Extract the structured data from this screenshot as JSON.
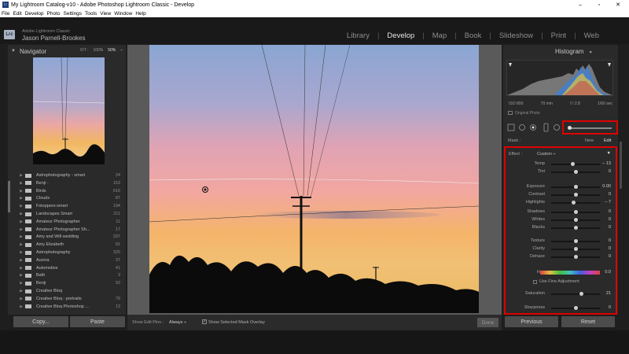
{
  "window": {
    "app_badge": "Lr",
    "title": "My Lightroom Catalog-v10 - Adobe Photoshop Lightroom Classic - Develop",
    "controls": [
      "–",
      "▫",
      "✕"
    ]
  },
  "menu": [
    "File",
    "Edit",
    "Develop",
    "Photo",
    "Settings",
    "Tools",
    "View",
    "Window",
    "Help"
  ],
  "identity": {
    "logo": "Lrc",
    "app_name": "Adobe Lightroom Classic",
    "user_name": "Jason Parnell-Brookes"
  },
  "modules": {
    "items": [
      "Library",
      "Develop",
      "Map",
      "Book",
      "Slideshow",
      "Print",
      "Web"
    ],
    "active": "Develop"
  },
  "navigator": {
    "title": "Navigator",
    "zoom_fit": "FIT :",
    "zoom_100": "100%",
    "zoom_50": "50%",
    "zoom_more": "÷"
  },
  "presets": [
    {
      "name": "Astrophotography - smart",
      "count": "24"
    },
    {
      "name": "Benji -",
      "count": "153"
    },
    {
      "name": "Birds",
      "count": "616"
    },
    {
      "name": "Clouds",
      "count": "87"
    },
    {
      "name": "Fstoppers-smart",
      "count": "194"
    },
    {
      "name": "Landscapes Smart",
      "count": "211"
    },
    {
      "name": "Amateur Photographer",
      "count": "11"
    },
    {
      "name": "Amateur Photographer Sh...",
      "count": "17"
    },
    {
      "name": "Amy and Will wedding",
      "count": "337"
    },
    {
      "name": "Amy Elizabeth",
      "count": "91"
    },
    {
      "name": "Astrophotography",
      "count": "325"
    },
    {
      "name": "Aurora",
      "count": "37"
    },
    {
      "name": "Automotive",
      "count": "41"
    },
    {
      "name": "Bath",
      "count": "3"
    },
    {
      "name": "Benji",
      "count": "93"
    },
    {
      "name": "Creative Bloq",
      "count": ""
    },
    {
      "name": "Creative Bloq - portraits",
      "count": "79"
    },
    {
      "name": "Creative Bloq Photoshop ...",
      "count": "13"
    }
  ],
  "left_buttons": {
    "copy": "Copy...",
    "paste": "Paste"
  },
  "toolbar": {
    "pins_label": "Show Edit Pins :",
    "pins_value": "Always ÷",
    "overlay_check": "✓",
    "overlay_label": "Show Selected Mask Overlay",
    "done": "Done"
  },
  "histogram": {
    "title": "Histogram",
    "iso": "ISO 800",
    "focal": "70 mm",
    "aperture": "f / 2.8",
    "shutter": "1/60 sec",
    "original": "Original Photo"
  },
  "mask": {
    "label": "Mask :",
    "new": "New",
    "edit": "Edit"
  },
  "effect": {
    "label": "Effect :",
    "value": "Custom ÷",
    "sliders": [
      {
        "name": "Temp",
        "value": "– 13",
        "position": 0.45
      },
      {
        "name": "Tint",
        "value": "0",
        "position": 0.5
      },
      {
        "name": "Exposure",
        "value": "0.00",
        "position": 0.5
      },
      {
        "name": "Contrast",
        "value": "0",
        "position": 0.5
      },
      {
        "name": "Highlights",
        "value": "– 7",
        "position": 0.46
      },
      {
        "name": "Shadows",
        "value": "0",
        "position": 0.5
      },
      {
        "name": "Whites",
        "value": "0",
        "position": 0.5
      },
      {
        "name": "Blacks",
        "value": "0",
        "position": 0.5
      },
      {
        "name": "Texture",
        "value": "0",
        "position": 0.5
      },
      {
        "name": "Clarity",
        "value": "0",
        "position": 0.5
      },
      {
        "name": "Dehaze",
        "value": "0",
        "position": 0.5
      }
    ],
    "hue_label": "Hue",
    "hue_value": "0.0",
    "fine_adjust": "Use Fine Adjustment",
    "saturation": {
      "name": "Saturation",
      "value": "21",
      "position": 0.62
    },
    "sharpness": {
      "name": "Sharpness",
      "value": "0",
      "position": 0.5
    }
  },
  "right_buttons": {
    "previous": "Previous",
    "reset": "Reset"
  },
  "colors": {
    "highlight_box": "#e00000",
    "active_module": "#e6e6e6"
  }
}
